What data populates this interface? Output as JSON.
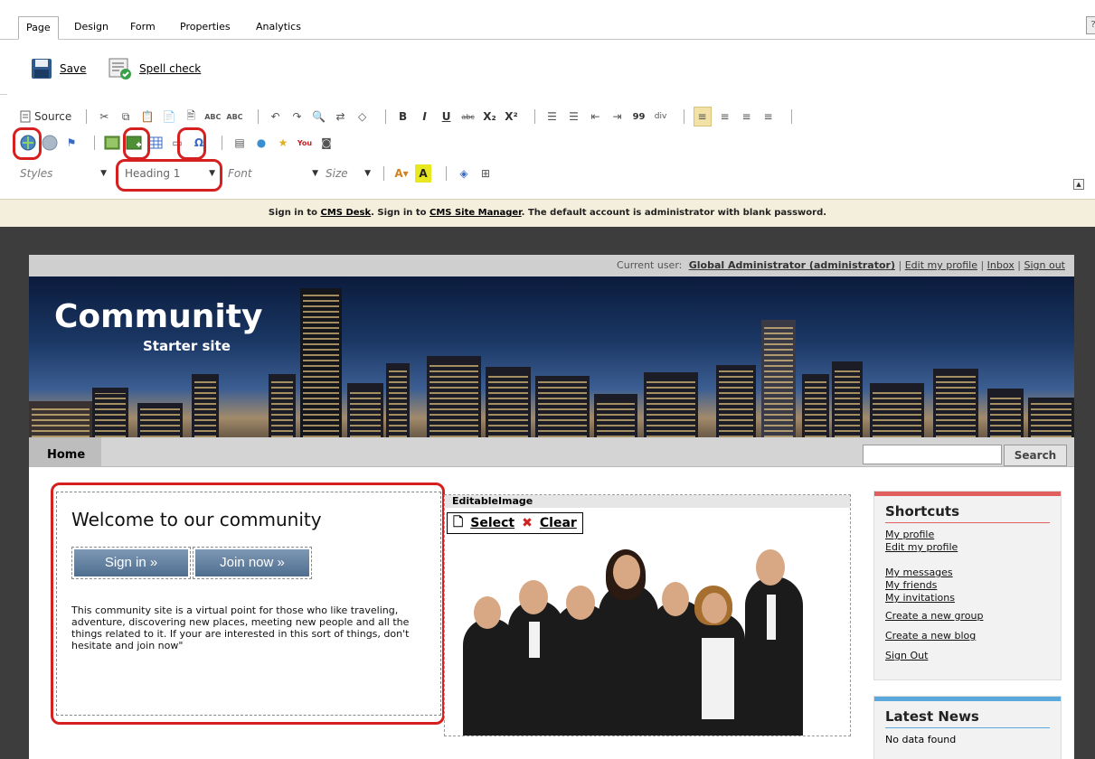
{
  "tabs": [
    "Page",
    "Design",
    "Form",
    "Properties",
    "Analytics"
  ],
  "help_label": "?",
  "actions": {
    "save": "Save",
    "spell_check": "Spell check"
  },
  "editor": {
    "source_label": "Source",
    "styles_placeholder": "Styles",
    "format_value": "Heading 1",
    "font_placeholder": "Font",
    "size_placeholder": "Size",
    "bold": "B",
    "italic": "I",
    "underline": "U",
    "strike": "abc",
    "sub": "X₂",
    "sup": "X²",
    "quote": "99",
    "omega": "Ω",
    "spellcheck_small": "ABC"
  },
  "infobar": {
    "part1": "Sign in to ",
    "cms_desk": "CMS Desk",
    "part2": ". Sign in to ",
    "site_manager": "CMS Site Manager",
    "part3": ". The default account is administrator with blank password."
  },
  "site": {
    "current_user_label": "Current user:",
    "current_user": "Global Administrator (administrator)",
    "edit_profile": "Edit my profile",
    "inbox": "Inbox",
    "sign_out": "Sign out",
    "logo_main": "Community",
    "logo_sub": "Starter site",
    "nav_home": "Home",
    "search_button": "Search",
    "welcome_title": "Welcome to our community",
    "sign_in_button": "Sign in »",
    "join_button": "Join now »",
    "welcome_text": "This community site is a virtual point for those who like traveling, adventure, discovering new places, meeting new people and all the things related to it. If your are interested in this sort of things, don't hesitate and join now\"",
    "editable_image_title": "EditableImage",
    "select": "Select",
    "clear": "Clear",
    "shortcuts_title": "Shortcuts",
    "shortcuts": [
      "My profile",
      "Edit my profile",
      "My messages",
      "My friends",
      "My invitations",
      "Create a new group",
      "Create a new blog",
      "Sign Out"
    ],
    "news_title": "Latest News",
    "news_empty": "No data found"
  },
  "colors": {
    "highlight": "#d62020",
    "infobar": "#f4efdc",
    "backdrop": "#3d3d3d",
    "shortcuts_bar": "#e06060",
    "news_bar": "#5aa8dc"
  }
}
